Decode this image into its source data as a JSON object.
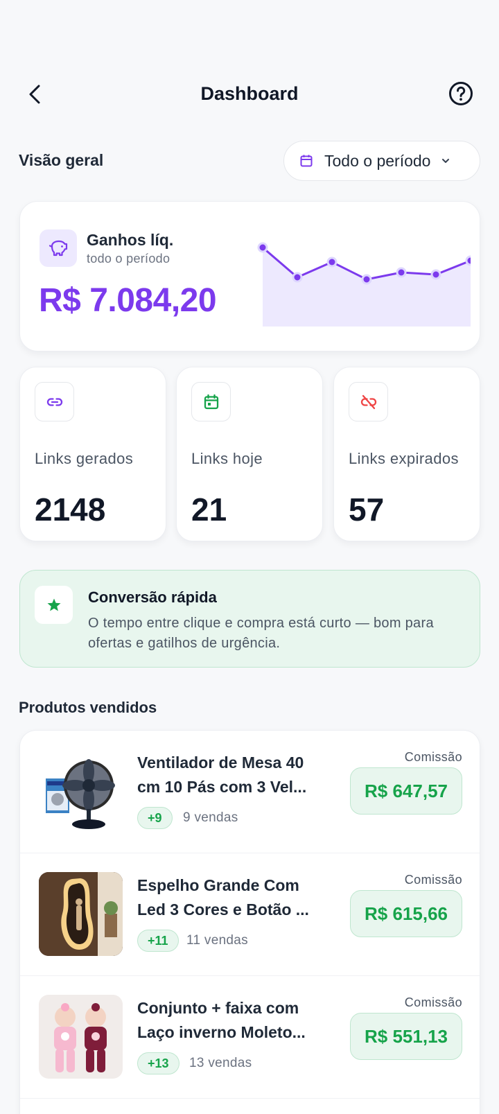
{
  "header": {
    "title": "Dashboard",
    "back_icon": "chevron-left-icon",
    "help_icon": "help-circle-icon"
  },
  "overview": {
    "label": "Visão geral",
    "period": "Todo o período"
  },
  "earnings": {
    "title": "Ganhos líq.",
    "subtitle": "todo o período",
    "value": "R$ 7.084,20",
    "accent": "#7c3aed"
  },
  "stats": [
    {
      "label": "Links gerados",
      "value": "2148",
      "icon": "link-icon",
      "color": "#7c3aed"
    },
    {
      "label": "Links hoje",
      "value": "21",
      "icon": "calendar-icon",
      "color": "#16a34a"
    },
    {
      "label": "Links expirados",
      "value": "57",
      "icon": "link-off-icon",
      "color": "#ef4444"
    }
  ],
  "tip": {
    "title": "Conversão rápida",
    "text": "O tempo entre clique e compra está curto — bom para ofertas e gatilhos de urgência.",
    "icon": "star-icon"
  },
  "products_section": {
    "title": "Produtos vendidos"
  },
  "products": [
    {
      "name_line1": "Ventilador de Mesa 40",
      "name_line2": "cm 10 Pás com 3 Vel...",
      "badge": "+9",
      "sales": "9 vendas",
      "commission_label": "Comissão",
      "commission": "R$ 647,57"
    },
    {
      "name_line1": "Espelho Grande Com",
      "name_line2": "Led 3 Cores e Botão ...",
      "badge": "+11",
      "sales": "11 vendas",
      "commission_label": "Comissão",
      "commission": "R$ 615,66"
    },
    {
      "name_line1": "Conjunto + faixa com",
      "name_line2": "Laço inverno Moleto...",
      "badge": "+13",
      "sales": "13 vendas",
      "commission_label": "Comissão",
      "commission": "R$ 551,13"
    }
  ],
  "colors": {
    "purple": "#7c3aed",
    "green": "#16a34a",
    "red": "#ef4444"
  }
}
